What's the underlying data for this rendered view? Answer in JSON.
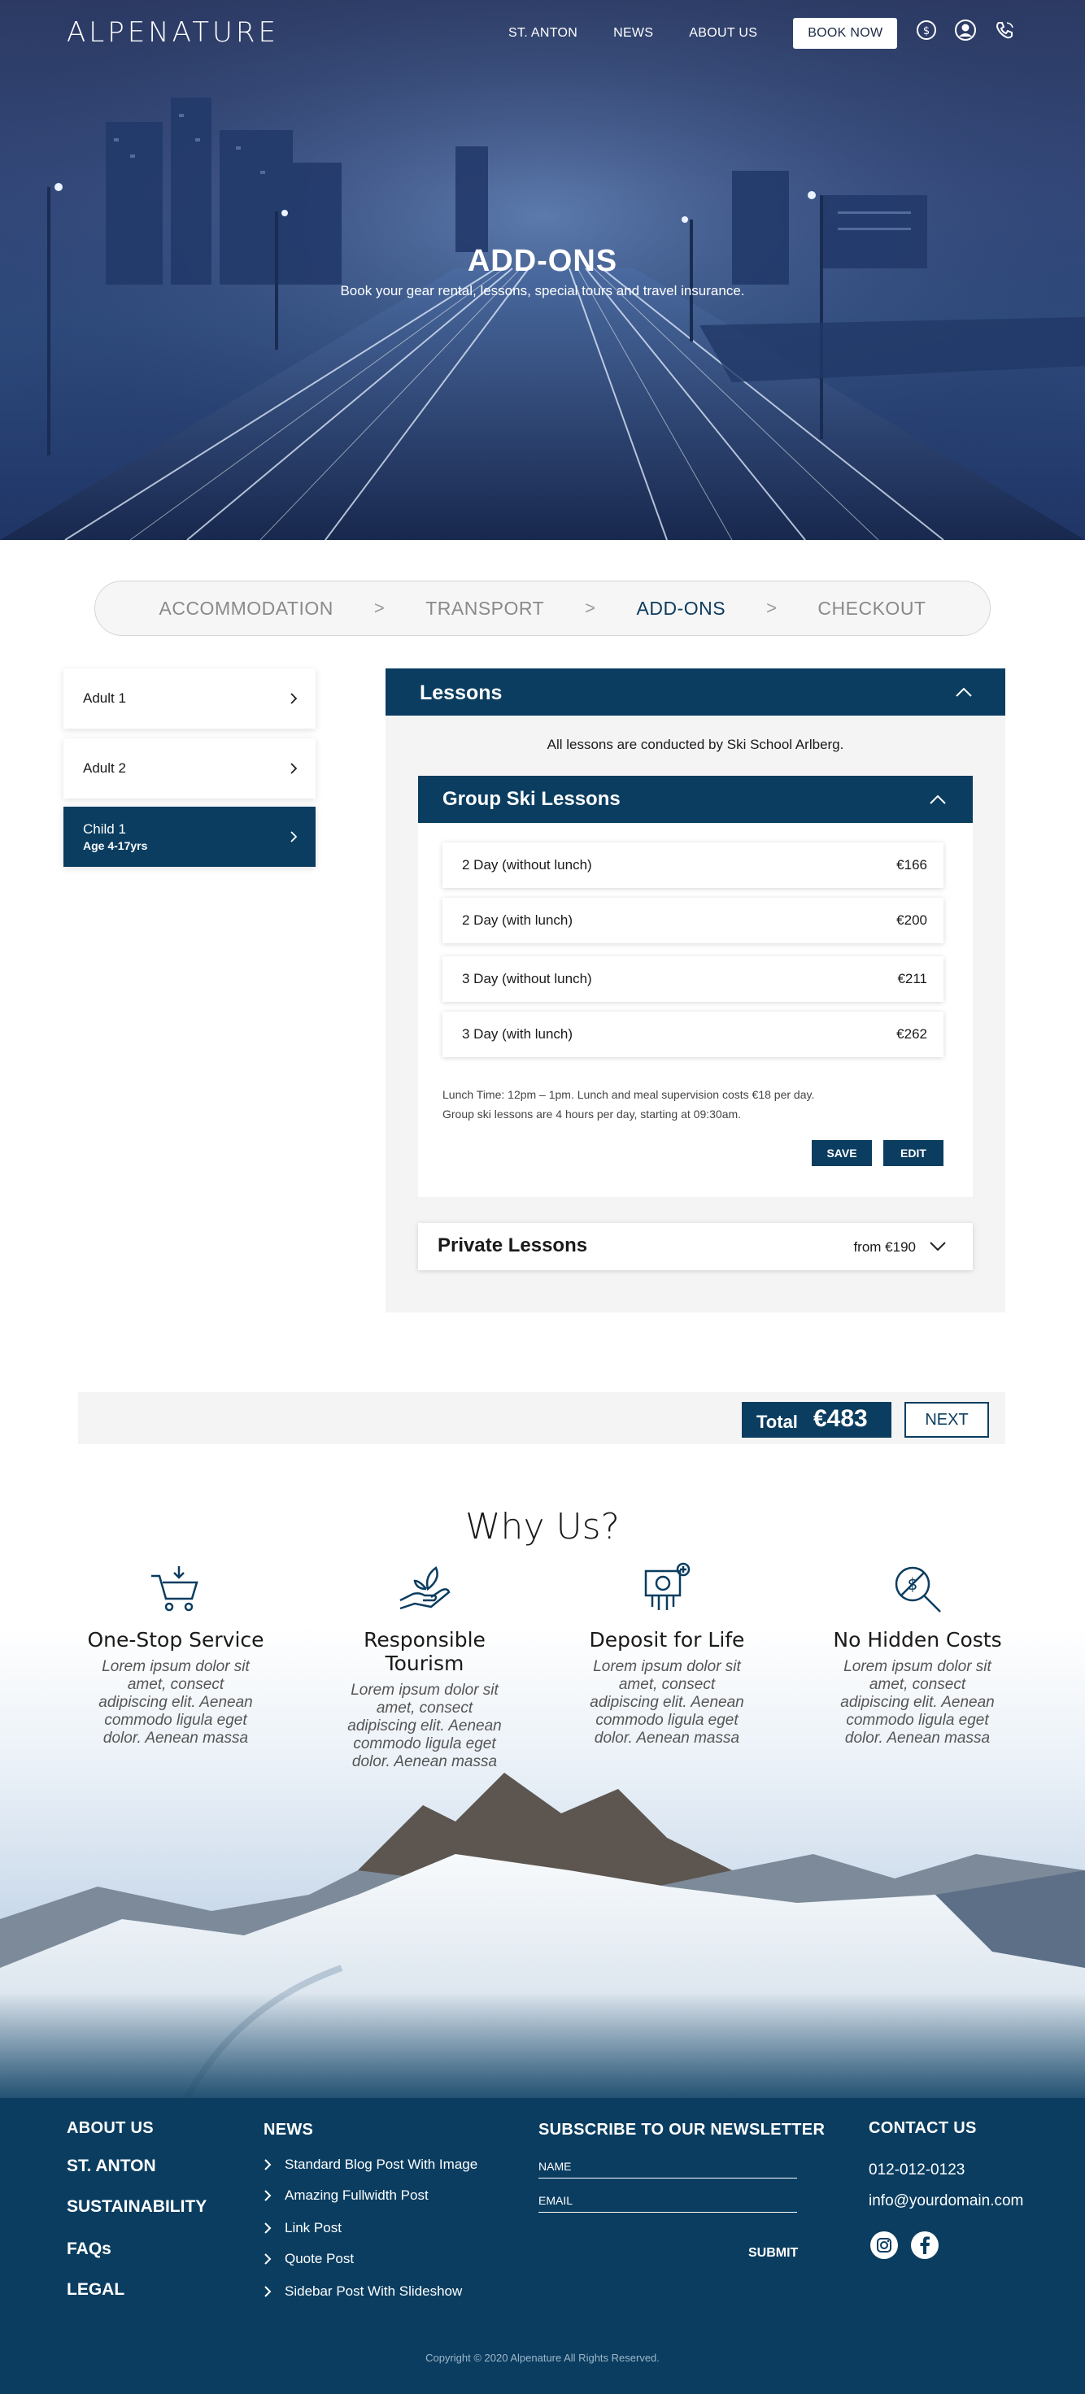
{
  "header": {
    "logo": "ALPENATURE",
    "nav": [
      "ST. ANTON",
      "NEWS",
      "ABOUT US"
    ],
    "book_now": "BOOK NOW",
    "icons": [
      "currency-exchange-icon",
      "user-icon",
      "phone-icon"
    ]
  },
  "hero": {
    "title": "ADD-ONS",
    "subtitle": "Book your gear rental, lessons, special tours and travel insurance."
  },
  "steps": {
    "items": [
      "ACCOMMODATION",
      "TRANSPORT",
      "ADD-ONS",
      "CHECKOUT"
    ],
    "separator": ">",
    "active": "ADD-ONS"
  },
  "travellers": [
    {
      "name": "Adult 1",
      "age": ""
    },
    {
      "name": "Adult 2",
      "age": ""
    },
    {
      "name": "Child 1",
      "age": "Age 4-17yrs"
    }
  ],
  "lessons": {
    "title": "Lessons",
    "note": "All lessons are conducted by Ski School Arlberg.",
    "group": {
      "title": "Group Ski Lessons",
      "options": [
        {
          "name": "2 Day (without lunch)",
          "price": "€166"
        },
        {
          "name": "2 Day (with lunch)",
          "price": "€200"
        },
        {
          "name": "3 Day (without lunch)",
          "price": "€211"
        },
        {
          "name": "3 Day (with lunch)",
          "price": "€262"
        }
      ],
      "note1": "Lunch Time: 12pm – 1pm. Lunch and meal supervision costs €18 per day.",
      "note2": "Group ski lessons are 4 hours per day, starting at 09:30am.",
      "save": "SAVE",
      "edit": "EDIT"
    },
    "private": {
      "title": "Private Lessons",
      "from": "from €190"
    }
  },
  "total": {
    "label": "Total",
    "value": "€483",
    "next": "NEXT"
  },
  "why": {
    "title": "Why Us?",
    "features": [
      {
        "title": "One-Stop Service",
        "text": "Lorem ipsum dolor sit amet, consect adipiscing elit. Aenean commodo ligula eget dolor. Aenean massa",
        "icon": "cart-icon"
      },
      {
        "title": "Responsible Tourism",
        "text": "Lorem ipsum dolor sit amet, consect adipiscing elit. Aenean commodo ligula eget dolor. Aenean massa",
        "icon": "hand-leaf-icon"
      },
      {
        "title": "Deposit for Life",
        "text": "Lorem ipsum dolor sit amet, consect adipiscing elit. Aenean commodo ligula eget dolor. Aenean massa",
        "icon": "money-deposit-icon"
      },
      {
        "title": "No Hidden Costs",
        "text": "Lorem ipsum dolor sit amet, consect adipiscing elit. Aenean commodo ligula eget dolor. Aenean massa",
        "icon": "magnify-dollar-icon"
      }
    ]
  },
  "footer": {
    "links": [
      "ABOUT US",
      "ST. ANTON",
      "SUSTAINABILITY",
      "FAQs",
      "LEGAL"
    ],
    "news_title": "NEWS",
    "news": [
      "Standard Blog Post With Image",
      "Amazing Fullwidth Post",
      "Link Post",
      "Quote Post",
      "Sidebar Post With Slideshow"
    ],
    "newsletter_title": "SUBSCRIBE TO OUR NEWSLETTER",
    "name_placeholder": "NAME",
    "email_placeholder": "EMAIL",
    "submit": "SUBMIT",
    "contact_title": "CONTACT US",
    "phone": "012-012-0123",
    "email": "info@yourdomain.com",
    "social": [
      "instagram-icon",
      "facebook-icon"
    ],
    "copyright": "Copyright © 2020  Alpenature  All Rights Reserved."
  }
}
